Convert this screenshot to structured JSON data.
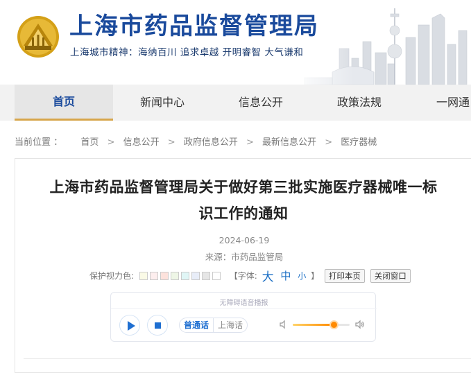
{
  "header": {
    "title": "上海市药品监督管理局",
    "slogan": "上海城市精神：海纳百川  追求卓越  开明睿智  大气谦和"
  },
  "nav": {
    "items": [
      {
        "label": "首页",
        "active": true
      },
      {
        "label": "新闻中心",
        "active": false
      },
      {
        "label": "信息公开",
        "active": false
      },
      {
        "label": "政策法规",
        "active": false
      },
      {
        "label": "一网通",
        "active": false
      }
    ]
  },
  "breadcrumb": {
    "label": "当前位置 ：",
    "items": [
      "首页",
      "信息公开",
      "政府信息公开",
      "最新信息公开",
      "医疗器械"
    ],
    "separator": ">"
  },
  "article": {
    "title_line1": "上海市药品监督管理局关于做好第三批实施医疗器械唯一标",
    "title_line2": "识工作的通知",
    "date": "2024-06-19",
    "source": "来源：市药品监管局"
  },
  "tools": {
    "eye_care_label": "保护视力色:",
    "swatches": [
      "#fafae6",
      "#fdeeee",
      "#fde2dc",
      "#eef6e6",
      "#e0f6f6",
      "#e8edf8",
      "#e6e6e6",
      "#ffffff"
    ],
    "font_label": "【字体:",
    "font_big": "大",
    "font_mid": "中",
    "font_small": "小",
    "font_close": "】",
    "print_label": "打印本页",
    "close_label": "关闭窗口"
  },
  "player": {
    "hint": "无障碍语音播报",
    "dialects": [
      "普通话",
      "上海话"
    ],
    "volume_level": 0.72,
    "accent": "#1f6fd1"
  },
  "colors": {
    "brand": "#1a4a9c",
    "nav_active_border": "#d7a64a"
  }
}
